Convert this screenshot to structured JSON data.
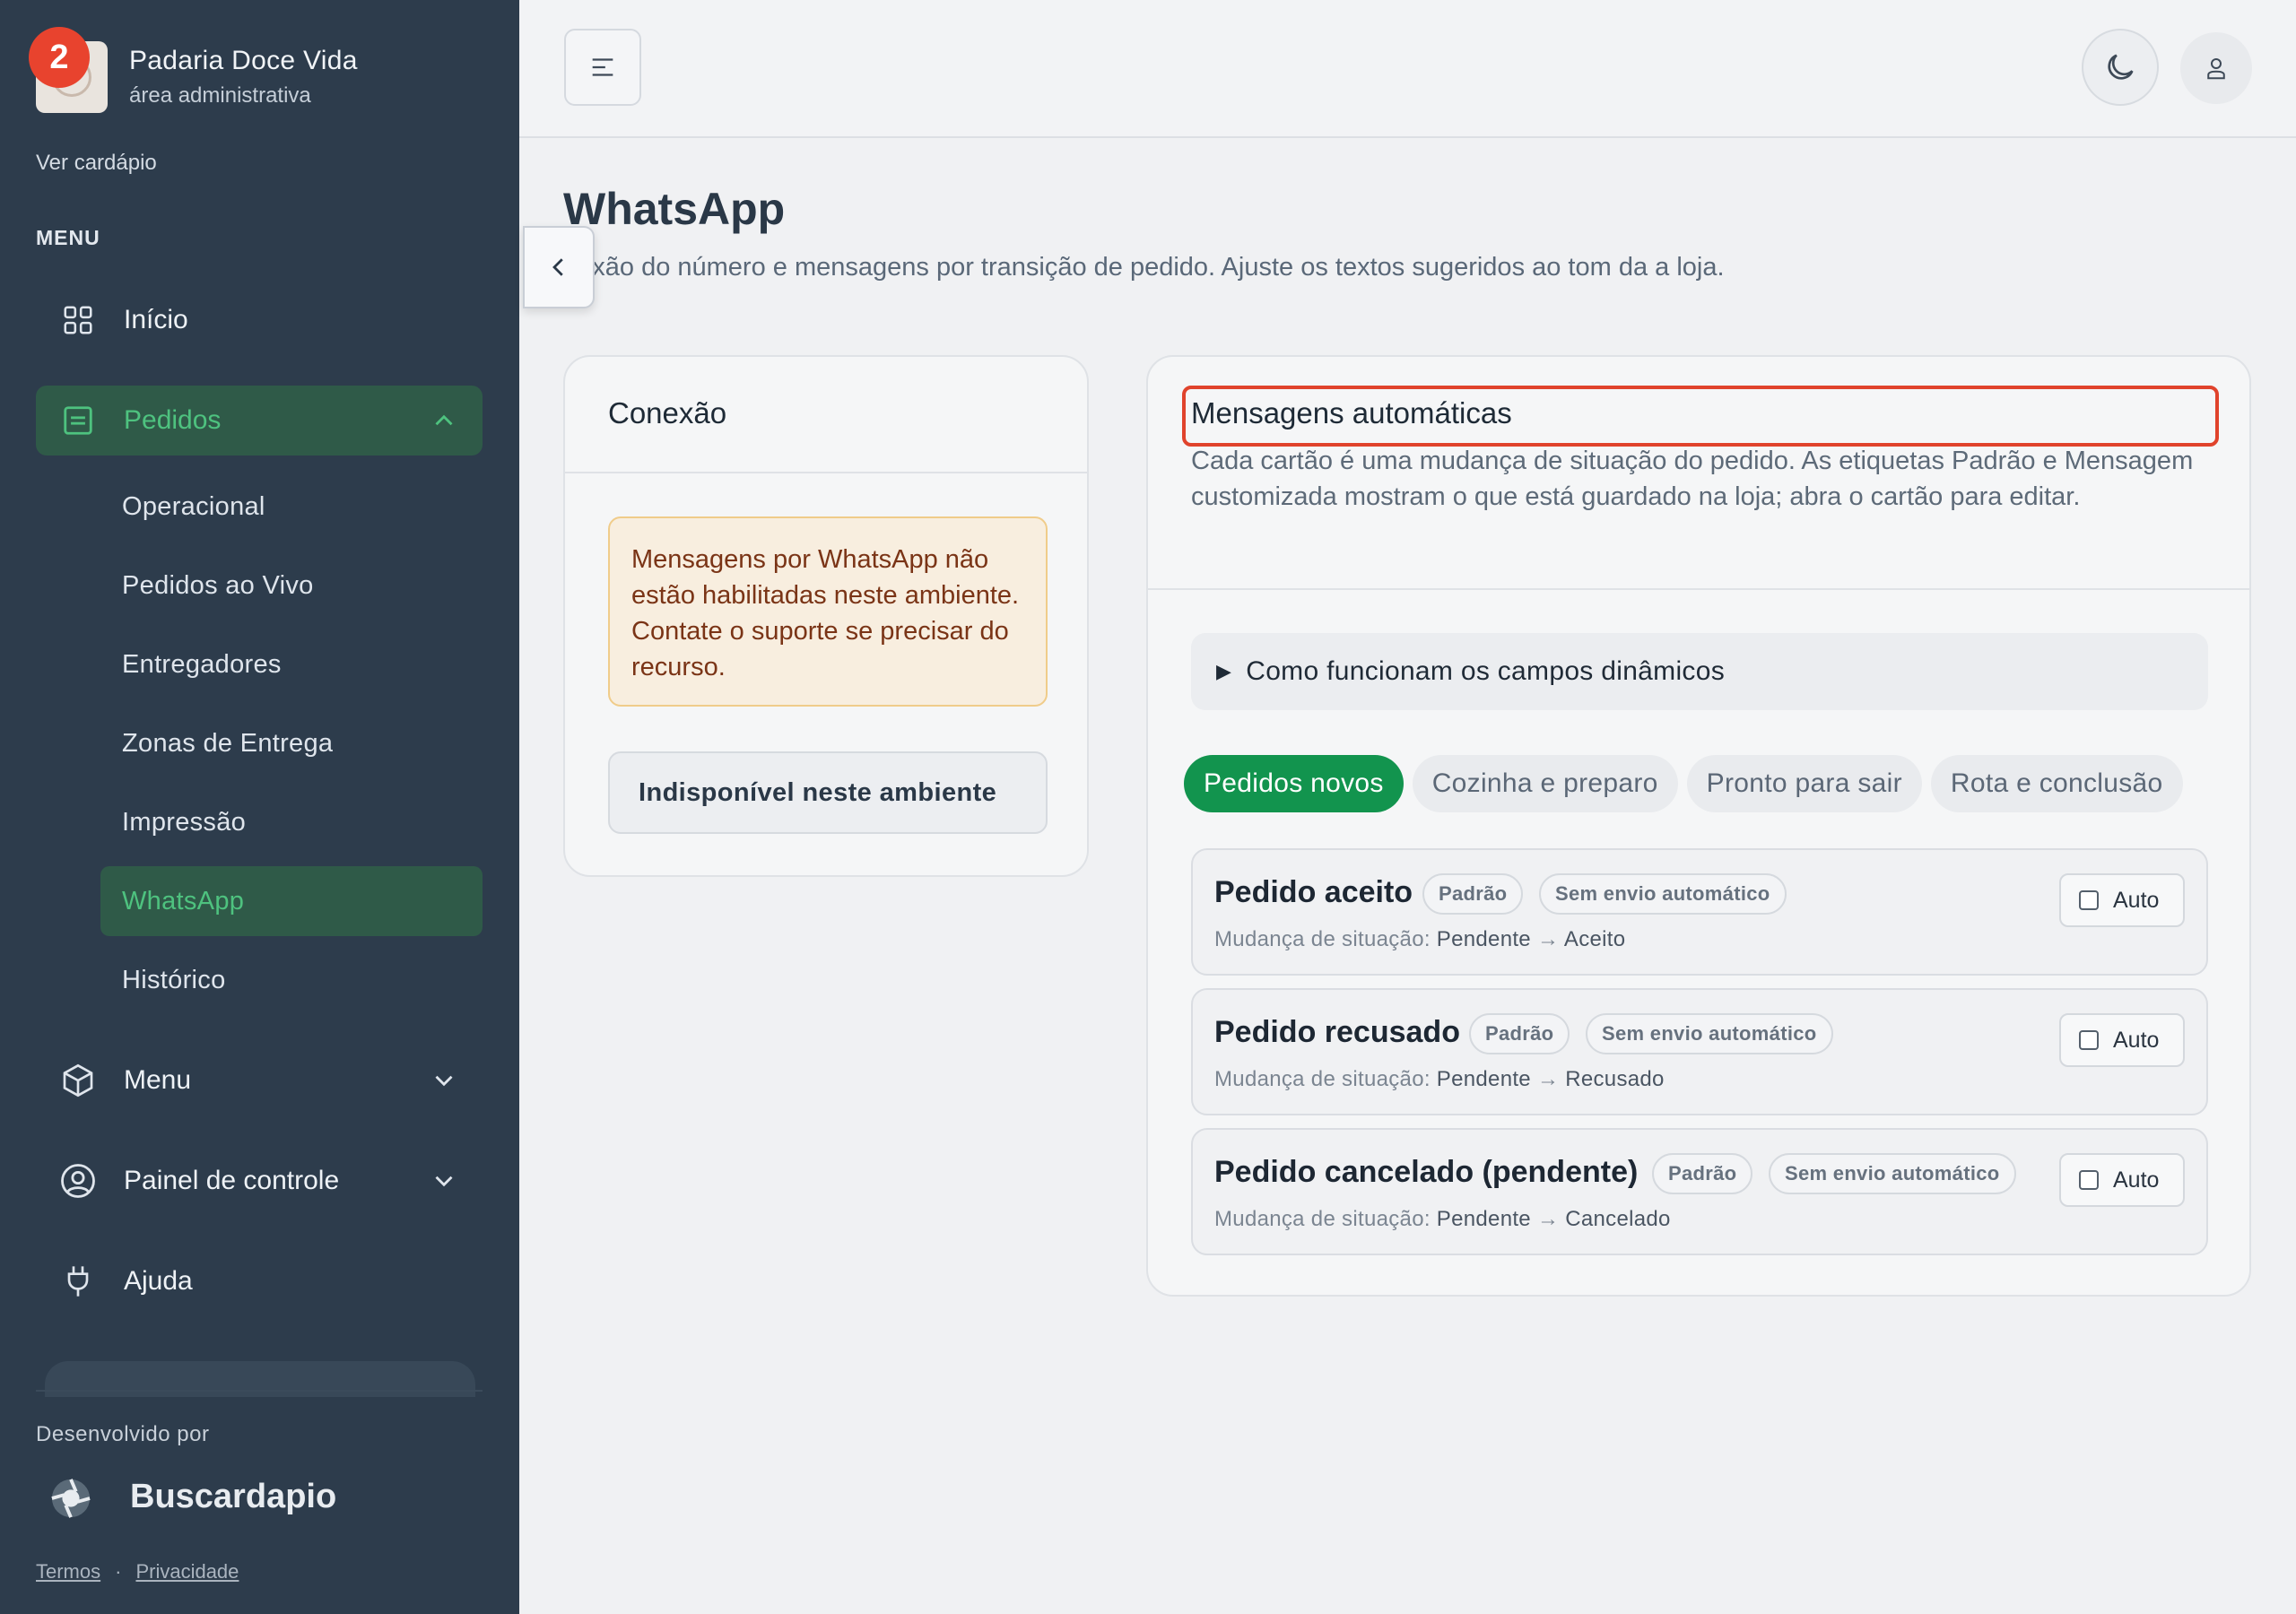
{
  "notification_count": "2",
  "brand": {
    "name": "Padaria Doce Vida",
    "subtitle": "área administrativa"
  },
  "sidebar": {
    "view_menu_link": "Ver cardápio",
    "section_label": "MENU",
    "items": {
      "inicio": "Início",
      "pedidos": "Pedidos",
      "menu": "Menu",
      "painel": "Painel de controle",
      "ajuda": "Ajuda"
    },
    "pedidos_sub": [
      "Operacional",
      "Pedidos ao Vivo",
      "Entregadores",
      "Zonas de Entrega",
      "Impressão",
      "WhatsApp",
      "Histórico"
    ],
    "developed_by": "Desenvolvido por",
    "developer": "Buscardapio",
    "terms": "Termos",
    "privacy": "Privacidade",
    "separator": "·"
  },
  "page": {
    "title": "WhatsApp",
    "description": "nexão do número e mensagens por transição de pedido. Ajuste os textos sugeridos ao tom da a loja."
  },
  "connection": {
    "title": "Conexão",
    "warning": "Mensagens por WhatsApp não estão habilitadas neste ambiente. Contate o suporte se precisar do recurso.",
    "button": "Indisponível neste ambiente"
  },
  "messages": {
    "title": "Mensagens automáticas",
    "description": "Cada cartão é uma mudança de situação do pedido. As etiquetas Padrão e Mensagem customizada mostram o que está guardado na loja; abra o cartão para editar.",
    "details_label": "Como funcionam os campos dinâmicos",
    "tabs": [
      "Pedidos novos",
      "Cozinha e preparo",
      "Pronto para sair",
      "Rota e conclusão"
    ],
    "change_label": "Mudança de situação:",
    "orders": [
      {
        "title": "Pedido aceito",
        "badge_default": "Padrão",
        "badge_send": "Sem envio automático",
        "from": "Pendente",
        "arrow": "→",
        "to": "Aceito",
        "auto_label": "Auto"
      },
      {
        "title": "Pedido recusado",
        "badge_default": "Padrão",
        "badge_send": "Sem envio automático",
        "from": "Pendente",
        "arrow": "→",
        "to": "Recusado",
        "auto_label": "Auto"
      },
      {
        "title": "Pedido cancelado (pendente)",
        "badge_default": "Padrão",
        "badge_send": "Sem envio automático",
        "from": "Pendente",
        "arrow": "→",
        "to": "Cancelado",
        "auto_label": "Auto"
      }
    ]
  },
  "colors": {
    "sidebar": "#2d3c4c",
    "accent": "#12944e",
    "active_text": "#4ec27f",
    "highlight": "#e0432c"
  }
}
